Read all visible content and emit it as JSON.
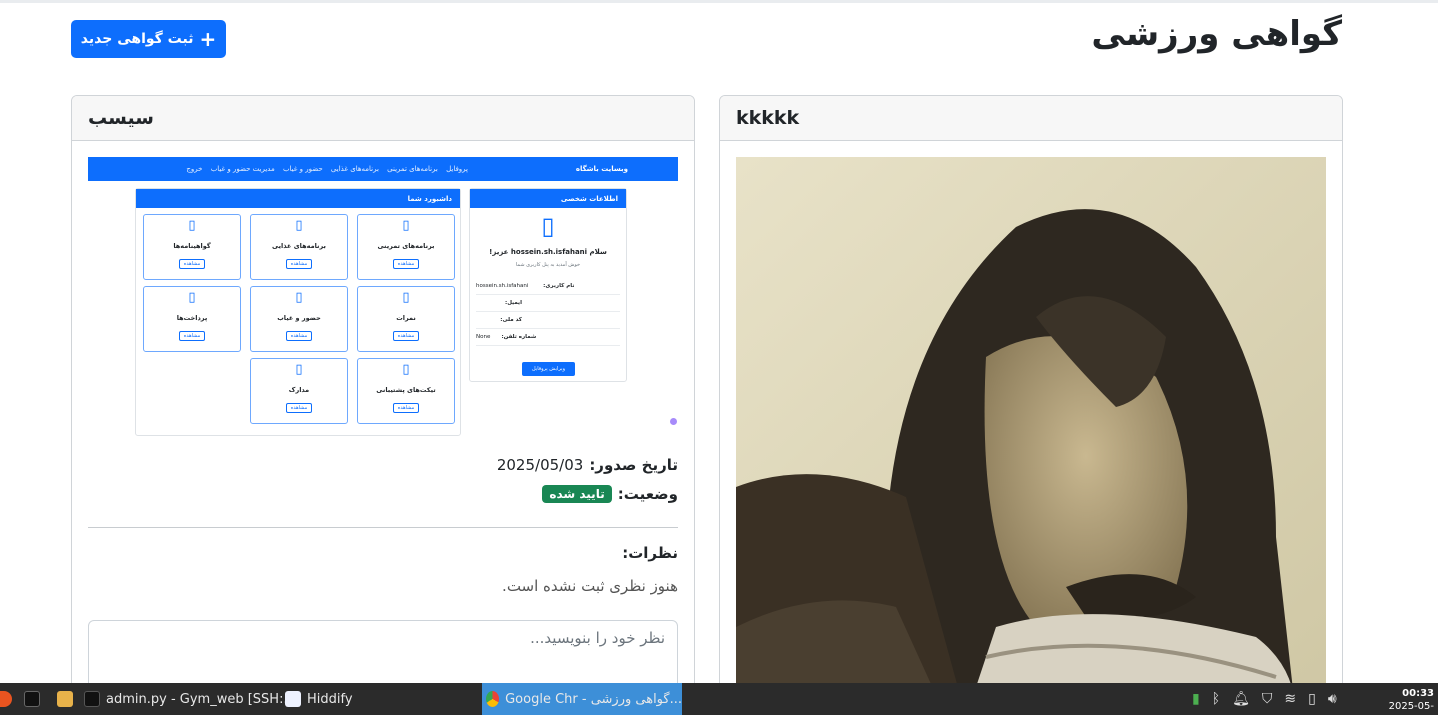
{
  "page": {
    "title": "گواهی ورزشی",
    "new_button_label": "ثبت گواهی جدید",
    "new_button_icon": "plus-icon"
  },
  "cards": [
    {
      "heading": "سیسب",
      "issue_date_label": "تاریخ صدور:",
      "issue_date": "2025/05/03",
      "status_label": "وضعیت:",
      "status": "تایید شده",
      "status_color": "#198754",
      "comments_label": "نظرات:",
      "no_comments": "هنوز نظری ثبت نشده است.",
      "comment_placeholder": "نظر خود را بنویسید...",
      "screenshot": {
        "brand": "وبسایت باشگاه",
        "nav_links": [
          "پروفایل",
          "برنامه‌های تمرینی",
          "برنامه‌های غذایی",
          "حضور و غیاب",
          "مدیریت حضور و غیاب",
          "خروج"
        ],
        "dashboard_title": "داشبورد شما",
        "view_label": "مشاهده",
        "tiles": [
          "برنامه‌های تمرینی",
          "برنامه‌های غذایی",
          "گواهینامه‌ها",
          "نمرات",
          "حضور و غیاب",
          "پرداخت‌ها",
          "تیکت‌های پشتیبانی",
          "مدارک"
        ],
        "profile_title": "اطلاعات شخصی",
        "greeting": "سلام hossein.sh.isfahani عزیز!",
        "welcome": "خوش آمدید به پنل کاربری شما",
        "rows": [
          {
            "key": "نام کاربری:",
            "value": "hossein.sh.isfahani"
          },
          {
            "key": "ایمیل:",
            "value": ""
          },
          {
            "key": "کد ملی:",
            "value": ""
          },
          {
            "key": "شماره تلفن:",
            "value": "None"
          }
        ],
        "edit_button": "ویرایش پروفایل"
      }
    },
    {
      "heading": "kkkkk"
    }
  ],
  "taskbar": {
    "items": [
      {
        "label": "admin.py - Gym_web [SSH:...",
        "icon": "vscode-icon"
      },
      {
        "label": "Hiddify",
        "icon": "hiddify-icon"
      },
      {
        "label": "Google Chr - گواهی ورزشی...",
        "icon": "chrome-icon"
      }
    ],
    "time": "00:33",
    "date": "2025-05-"
  }
}
